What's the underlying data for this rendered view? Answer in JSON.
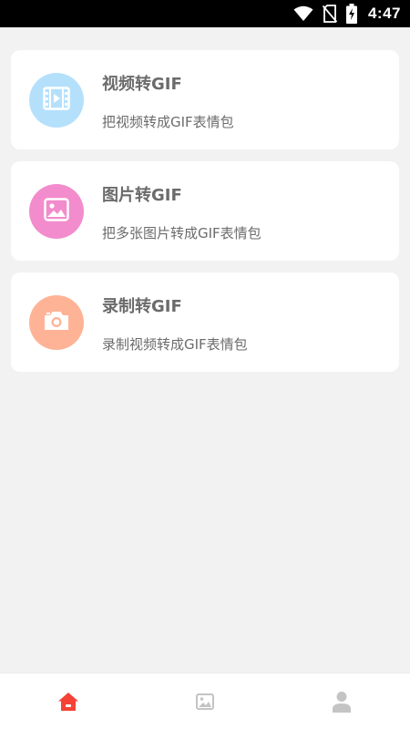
{
  "status_bar": {
    "time": "4:47",
    "icons": [
      "wifi-icon",
      "no-sim-icon",
      "battery-charging-icon"
    ]
  },
  "cards": [
    {
      "title": "视频转GIF",
      "desc": "把视频转成GIF表情包",
      "icon": "video-film-icon",
      "color": "#b5e0fc"
    },
    {
      "title": "图片转GIF",
      "desc": "把多张图片转成GIF表情包",
      "icon": "image-icon",
      "color": "#f28ccc"
    },
    {
      "title": "录制转GIF",
      "desc": "录制视频转成GIF表情包",
      "icon": "camera-icon",
      "color": "#ffb396"
    }
  ],
  "bottom_nav": {
    "items": [
      {
        "icon": "home-icon",
        "active": true
      },
      {
        "icon": "gallery-icon",
        "active": false
      },
      {
        "icon": "profile-icon",
        "active": false
      }
    ],
    "active_color": "#f44336",
    "inactive_color": "#c4c4c4"
  }
}
